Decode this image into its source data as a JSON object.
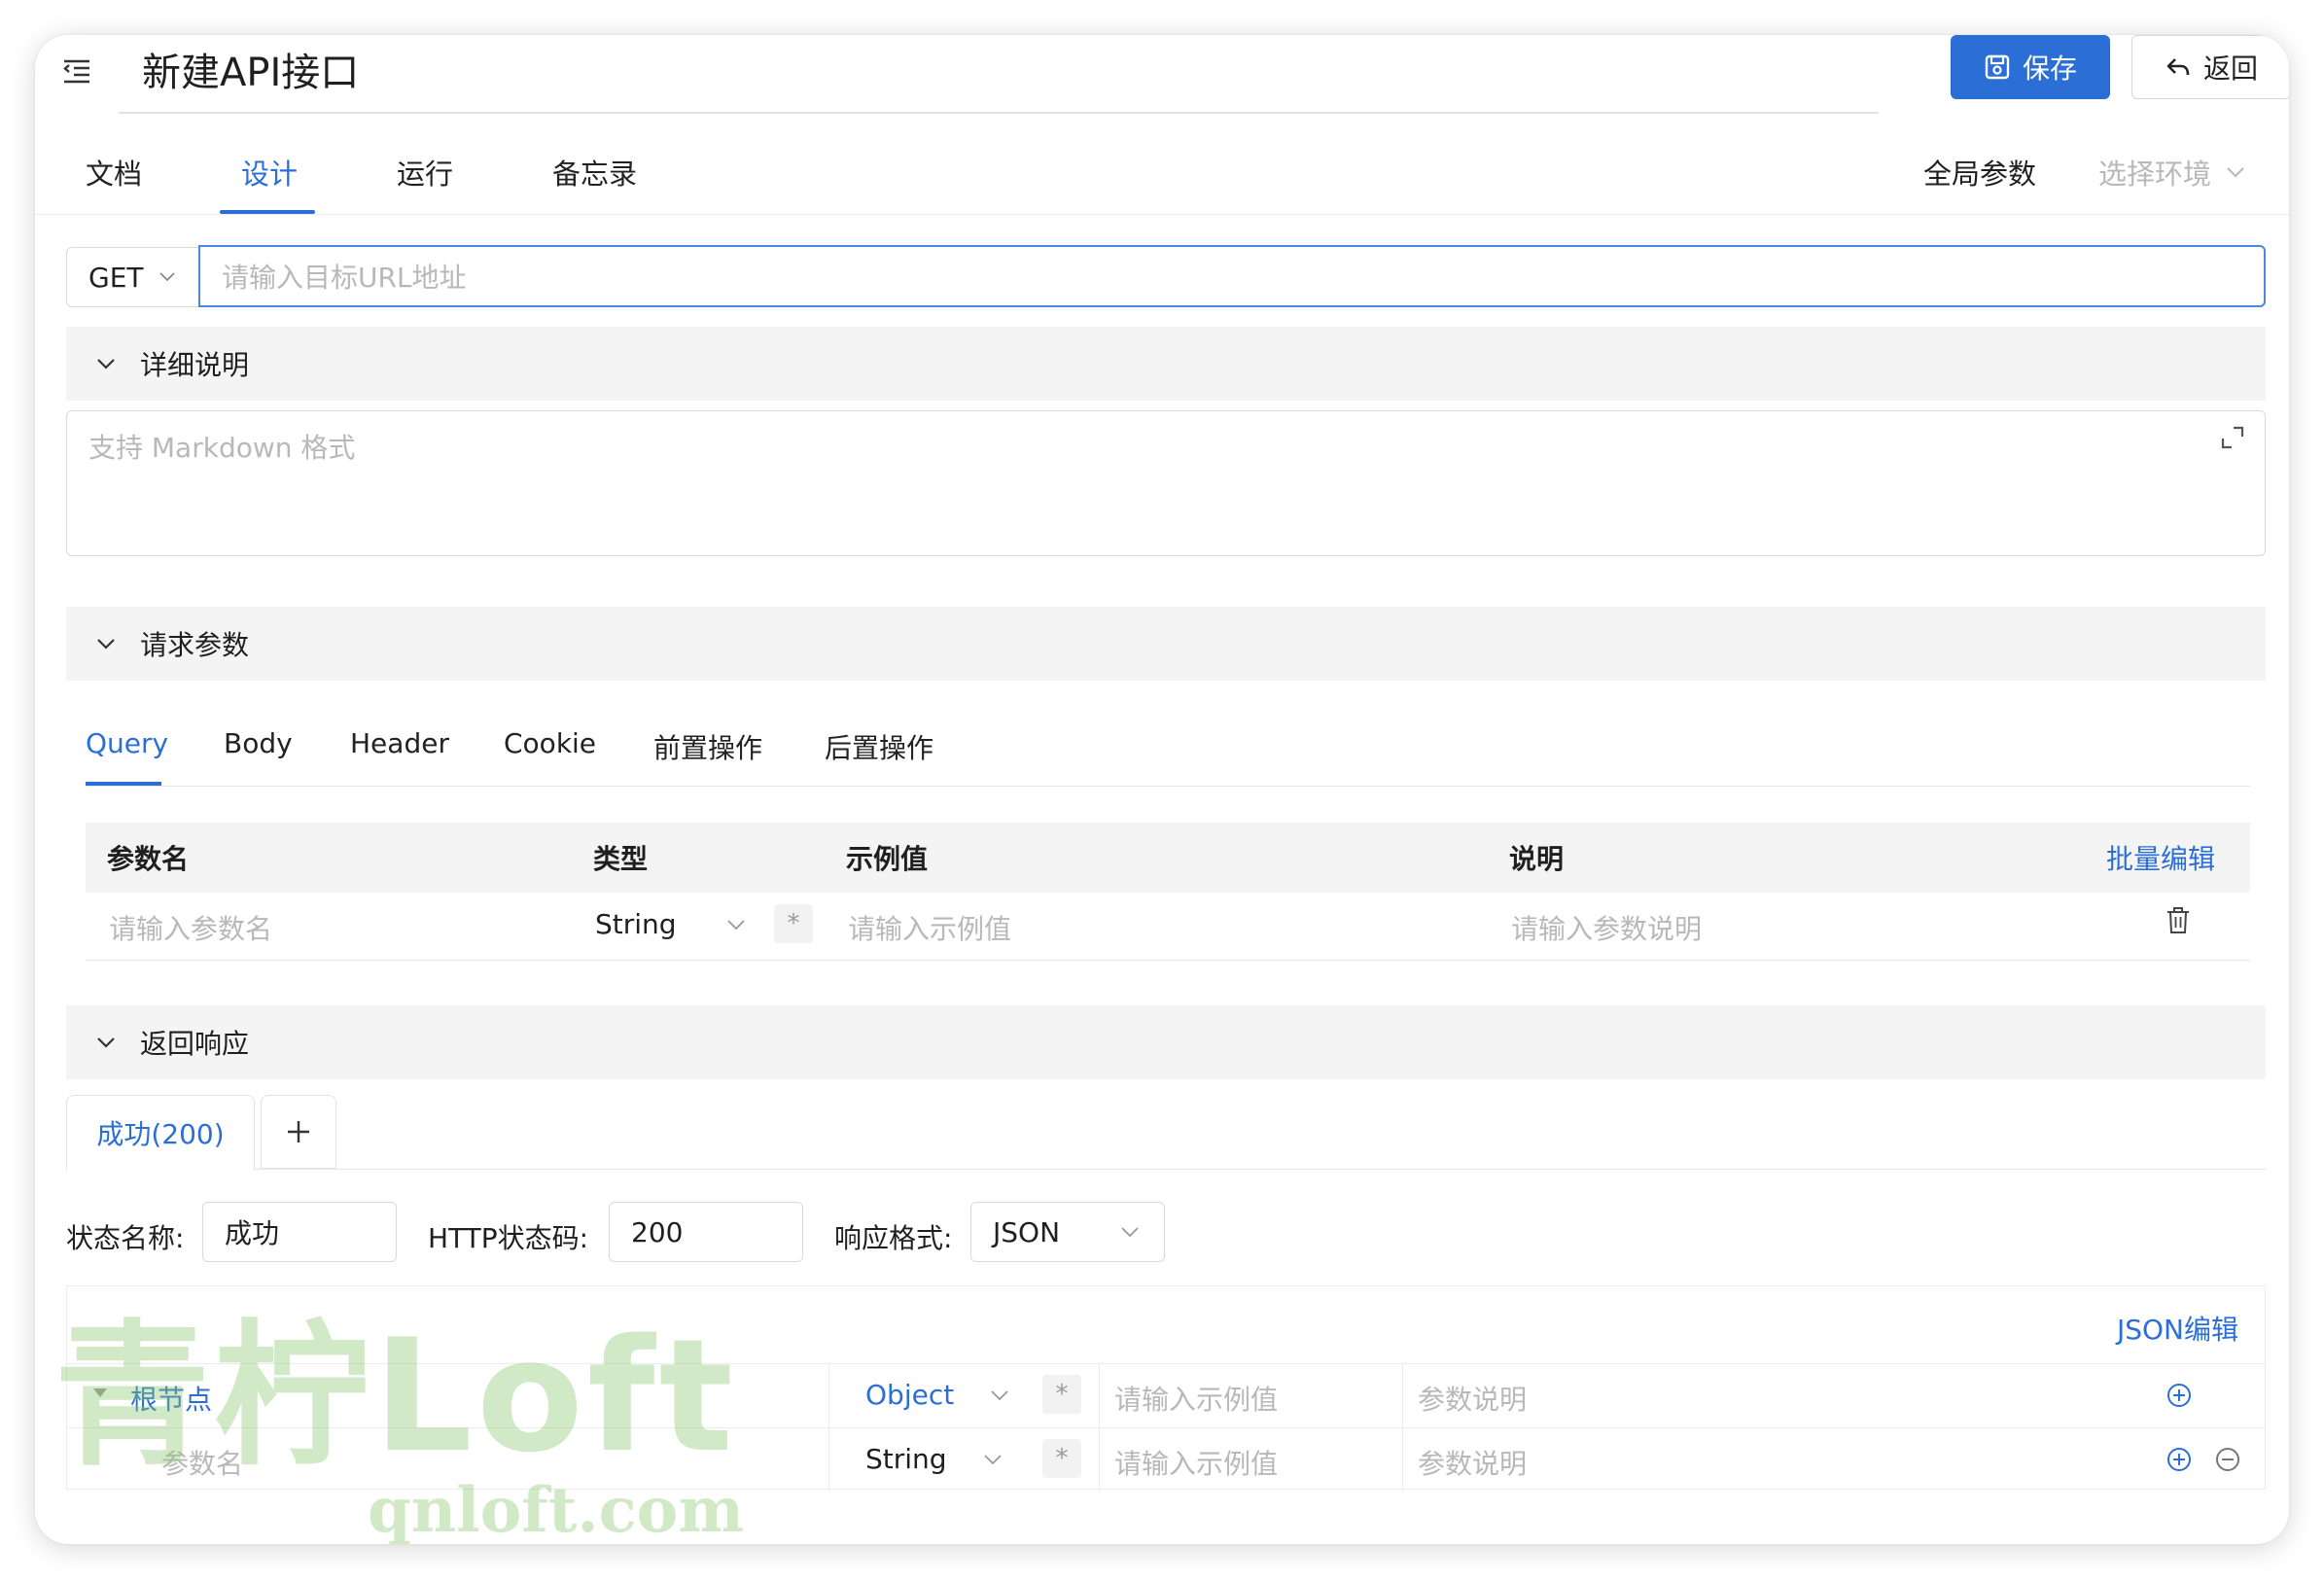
{
  "header": {
    "title": "新建API接口",
    "save_label": "保存",
    "back_label": "返回"
  },
  "tabs": [
    "文档",
    "设计",
    "运行",
    "备忘录"
  ],
  "active_tab": "设计",
  "global_params_label": "全局参数",
  "env_select_placeholder": "选择环境",
  "url_row": {
    "method": "GET",
    "url_placeholder": "请输入目标URL地址"
  },
  "description": {
    "section_title": "详细说明",
    "placeholder": "支持 Markdown 格式"
  },
  "request_params": {
    "section_title": "请求参数",
    "tabs": [
      "Query",
      "Body",
      "Header",
      "Cookie",
      "前置操作",
      "后置操作"
    ],
    "active_tab": "Query",
    "columns": [
      "参数名",
      "类型",
      "示例值",
      "说明"
    ],
    "bulk_edit_label": "批量编辑",
    "row": {
      "name_placeholder": "请输入参数名",
      "type": "String",
      "required_mark": "*",
      "example_placeholder": "请输入示例值",
      "desc_placeholder": "请输入参数说明"
    }
  },
  "response": {
    "section_title": "返回响应",
    "tab_label": "成功(200)",
    "add_tab_symbol": "+",
    "status_name_label": "状态名称:",
    "status_name_value": "成功",
    "http_code_label": "HTTP状态码:",
    "http_code_value": "200",
    "format_label": "响应格式:",
    "format_value": "JSON",
    "json_edit_label": "JSON编辑",
    "rows": [
      {
        "name": "根节点",
        "type": "Object",
        "required_mark": "*",
        "example_placeholder": "请输入示例值",
        "desc_placeholder": "参数说明"
      },
      {
        "name_placeholder": "参数名",
        "type": "String",
        "required_mark": "*",
        "example_placeholder": "请输入示例值",
        "desc_placeholder": "参数说明"
      }
    ]
  },
  "watermark": {
    "text": "青柠Loft",
    "url": "qnloft.com"
  },
  "colors": {
    "accent": "#2b6fd6",
    "section_bg": "#f4f4f5",
    "placeholder": "#b8b8b8",
    "watermark": "#8ac46e"
  }
}
